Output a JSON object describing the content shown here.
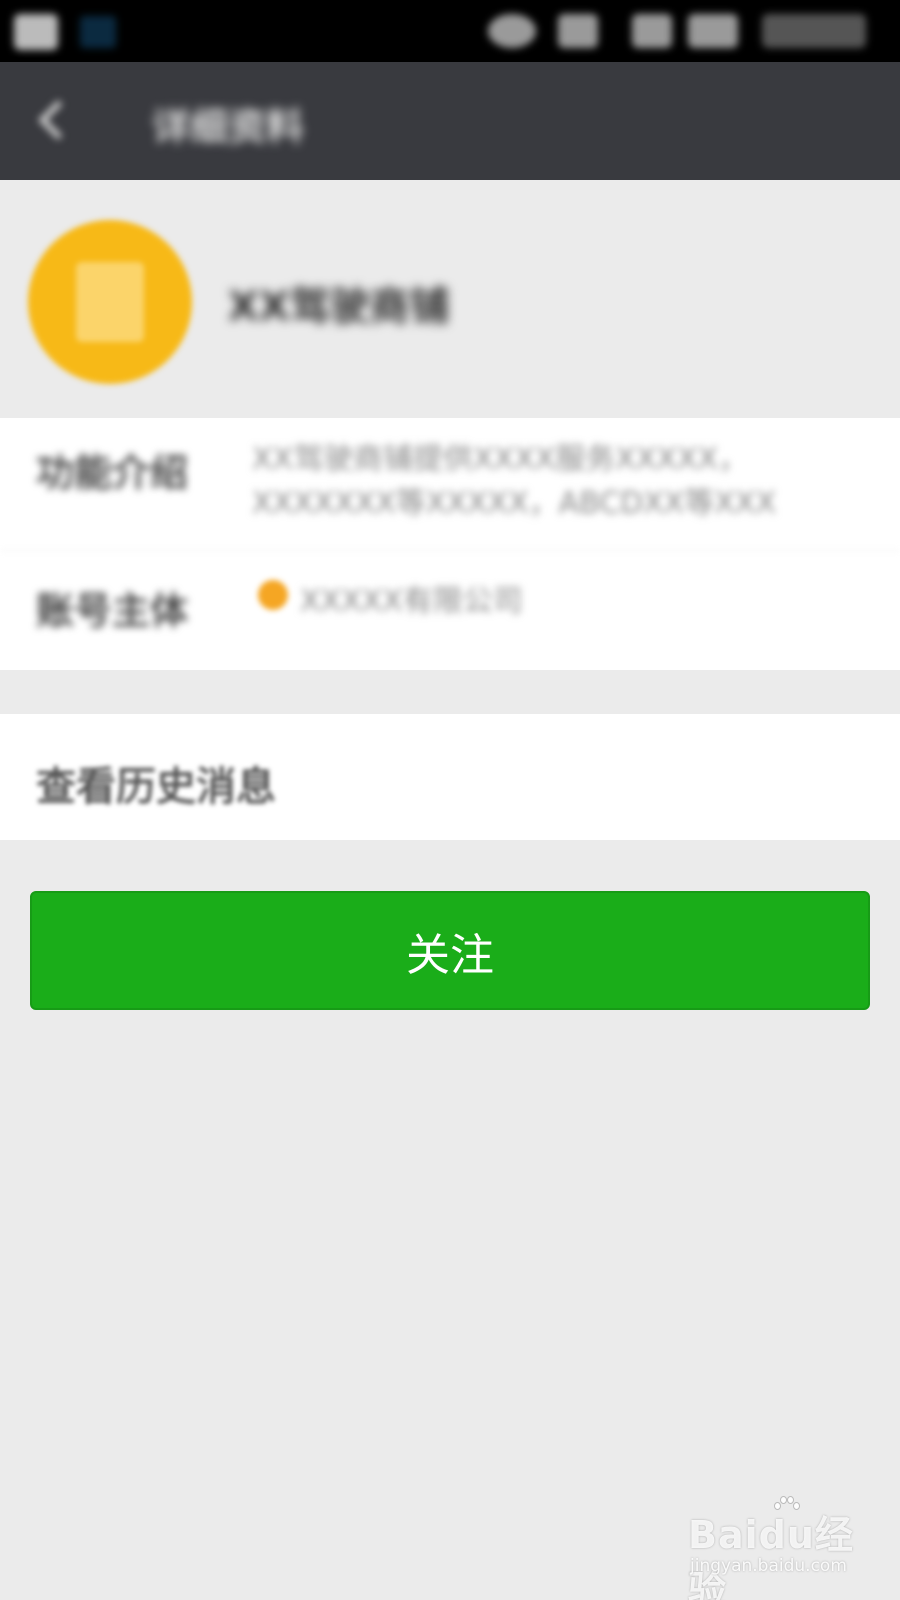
{
  "status_bar": {
    "icons": [
      "app-icon",
      "notification-icon",
      "eye-icon",
      "phone-icon",
      "signal-icon",
      "battery-icon",
      "clock-icon"
    ]
  },
  "header": {
    "back_icon": "back-arrow-icon",
    "title": "详细资料"
  },
  "profile": {
    "avatar_color": "#f7b917",
    "name": "XX驾驶商铺"
  },
  "info": {
    "rows": [
      {
        "label": "功能介绍",
        "value": "XX驾驶商铺提供XXXX服务XXXXX，XXXXXXX等XXXXX，ABCDXX等XXX"
      },
      {
        "label": "账号主体",
        "value": "XXXXX有限公司",
        "badge_icon": "verified-icon"
      }
    ]
  },
  "history": {
    "label": "查看历史消息"
  },
  "actions": {
    "follow_label": "关注",
    "follow_color": "#1aad19"
  },
  "watermark": {
    "brand": "Baidu经验",
    "url": "jingyan.baidu.com"
  }
}
